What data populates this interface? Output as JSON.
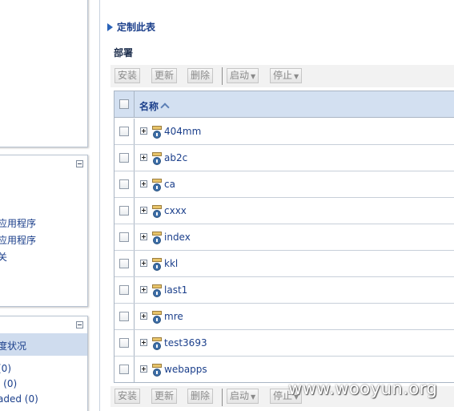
{
  "left_panels": {
    "panel2": {
      "links": [
        "应用程序",
        "应用程序",
        "关"
      ]
    },
    "panel3": {
      "selected": "度状况",
      "links": [
        "(0)",
        "l (0)",
        "aded (0)"
      ]
    }
  },
  "customize_link": "定制此表",
  "section_title": "部署",
  "toolbar": {
    "install": "安装",
    "update": "更新",
    "delete": "删除",
    "start": "启动",
    "stop": "停止"
  },
  "table": {
    "name_header": "名称",
    "rows": [
      {
        "name": "404mm"
      },
      {
        "name": "ab2c"
      },
      {
        "name": "ca"
      },
      {
        "name": "cxxx"
      },
      {
        "name": "index"
      },
      {
        "name": "kkl"
      },
      {
        "name": "last1"
      },
      {
        "name": "mre"
      },
      {
        "name": "test3693"
      },
      {
        "name": "webapps"
      }
    ]
  },
  "watermark": "www.wooyun.org"
}
